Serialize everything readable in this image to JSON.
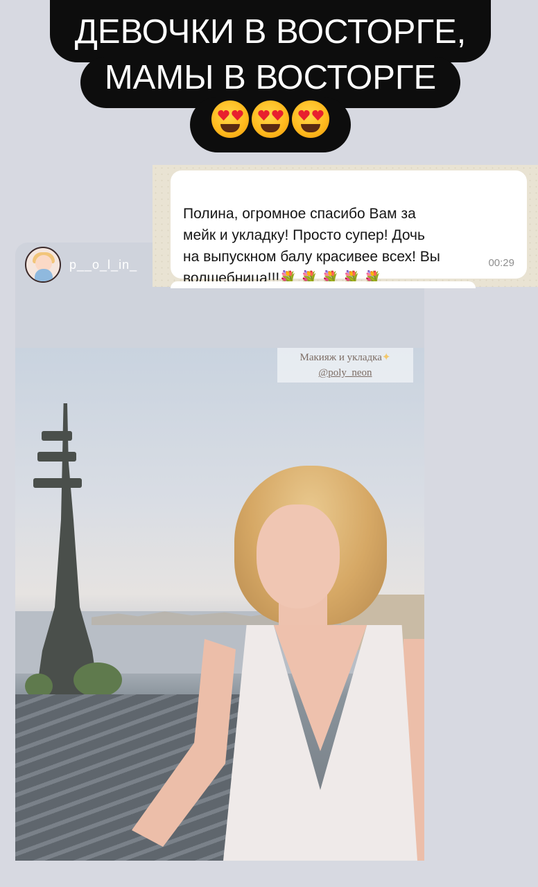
{
  "headline": {
    "line1": "ДЕВОЧКИ В ВОСТОРГЕ,",
    "line2": "МАМЫ В ВОСТОРГЕ",
    "emojis": [
      "heart-eyes-emoji",
      "heart-eyes-emoji",
      "heart-eyes-emoji"
    ]
  },
  "chat": {
    "message": "Полина, огромное спасибо Вам за\nмейк и укладку!  Просто супер! Дочь\nна выпускном балу красивее всех! Вы\nволшебница!!!",
    "flowers": "💐 💐 💐 💐 💐",
    "time": "00:29",
    "background_color": "#e9e3d3"
  },
  "story": {
    "username": "p__o_l_in_",
    "caption_line1": "Макияж и укладка",
    "caption_line2": "@poly_neon",
    "avatar_icon": "avatar-icon"
  }
}
